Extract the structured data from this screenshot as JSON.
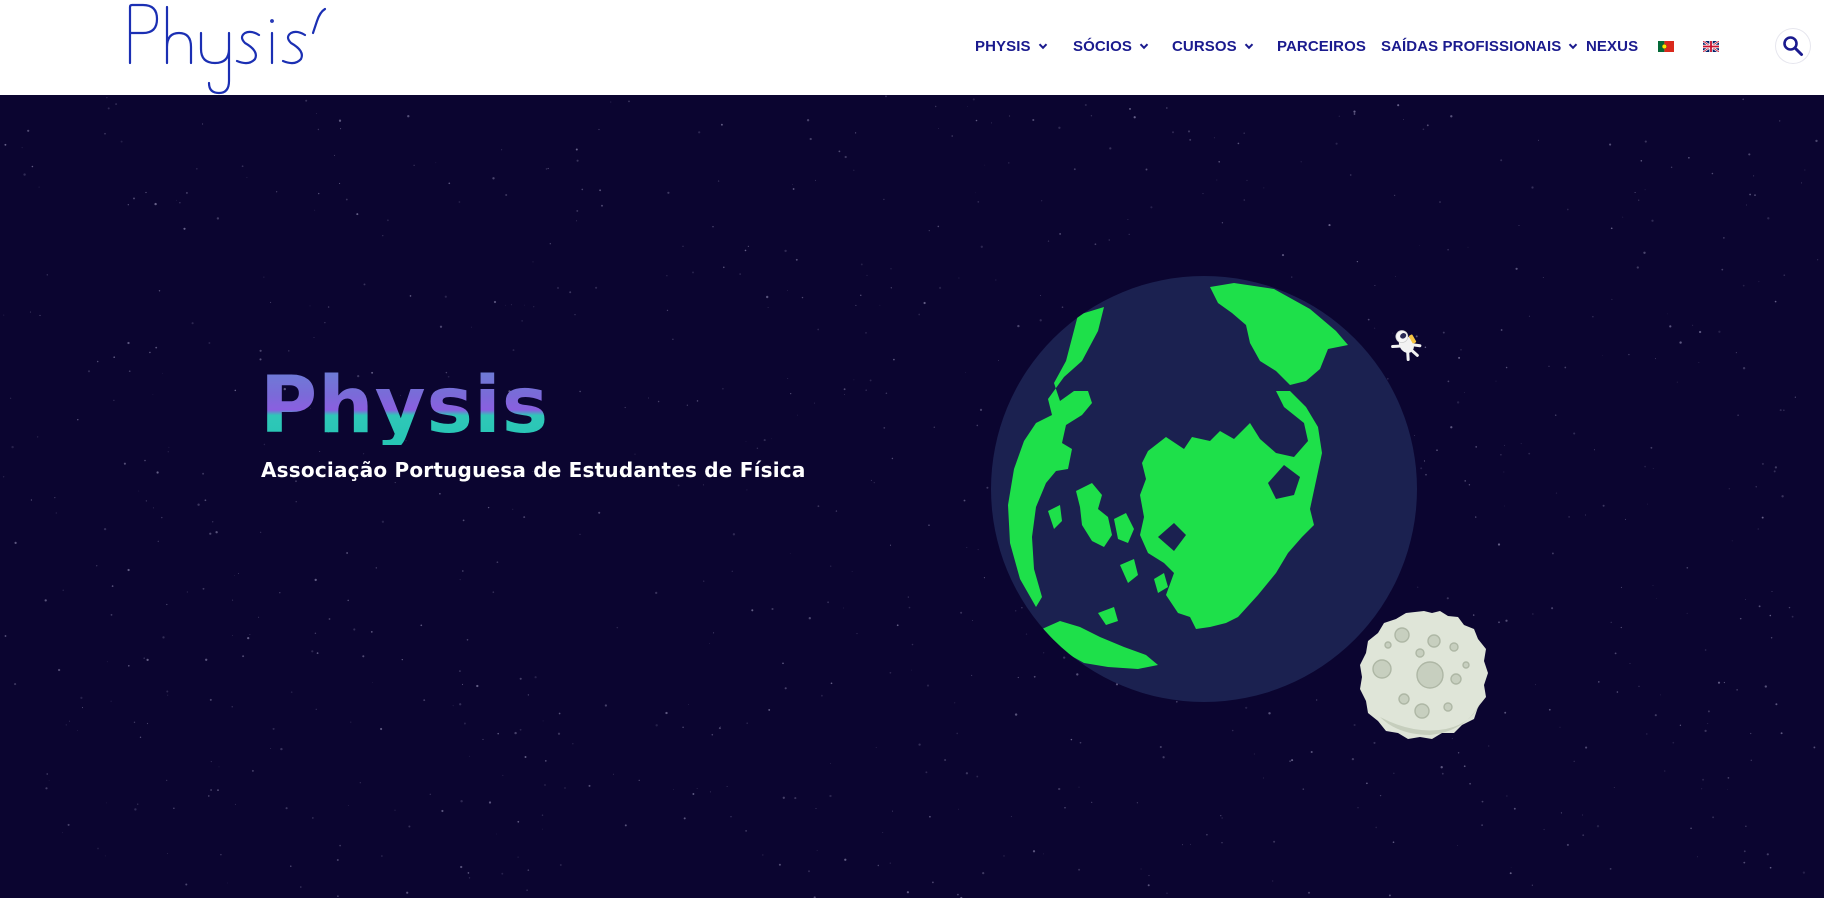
{
  "header": {
    "logo_text": "Physis",
    "nav": [
      {
        "label": "PHYSIS",
        "has_dropdown": true
      },
      {
        "label": "SÓCIOS",
        "has_dropdown": true
      },
      {
        "label": "CURSOS",
        "has_dropdown": true
      },
      {
        "label": "PARCEIROS",
        "has_dropdown": false
      },
      {
        "label": "SAÍDAS PROFISSIONAIS",
        "has_dropdown": true
      },
      {
        "label": "NEXUS",
        "has_dropdown": false
      }
    ],
    "languages": [
      "pt-flag-icon",
      "uk-flag-icon"
    ],
    "search_icon": "search-icon"
  },
  "hero": {
    "title": "Physis",
    "subtitle": "Associação Portuguesa de Estudantes de Física"
  },
  "colors": {
    "nav_text": "#1a1a8e",
    "hero_background": "#0b0530",
    "earth_ocean": "#1b2150",
    "earth_land": "#1ee04a",
    "moon": "#d9dfd3"
  }
}
